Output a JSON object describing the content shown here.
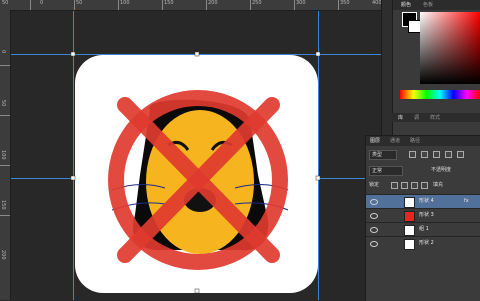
{
  "rulers": {
    "top_numbers": [
      "50",
      "0",
      "50",
      "100",
      "150",
      "200",
      "250",
      "300",
      "350",
      "400"
    ],
    "left_numbers": [
      "0",
      "50",
      "100",
      "150",
      "200"
    ]
  },
  "panel": {
    "tabs": [
      "颜色",
      "色板"
    ]
  },
  "adjustments": {
    "tabs": [
      "库",
      "调",
      "样式"
    ]
  },
  "layers": {
    "tabs": [
      "图层",
      "通道",
      "路径"
    ],
    "filter_label": "类型",
    "mode_label": "正常",
    "opacity_label": "不透明度",
    "fill_label": "填充",
    "lock_label": "锁定",
    "rows": [
      {
        "name": "形状 4",
        "fx": "fx",
        "thumb": "white",
        "selected": true
      },
      {
        "name": "形状 3",
        "fx": "",
        "thumb": "red",
        "selected": false
      },
      {
        "name": "组 1",
        "fx": "",
        "thumb": "white",
        "selected": false
      },
      {
        "name": "形状 2",
        "fx": "",
        "thumb": "white",
        "selected": false
      }
    ]
  },
  "colors": {
    "prohibition_red": "#e03a2f",
    "face_yellow": "#f6b51e",
    "hair_black": "#0a0a0a",
    "guide_blue": "#3fa0ff",
    "selection_blue": "#51709a"
  }
}
